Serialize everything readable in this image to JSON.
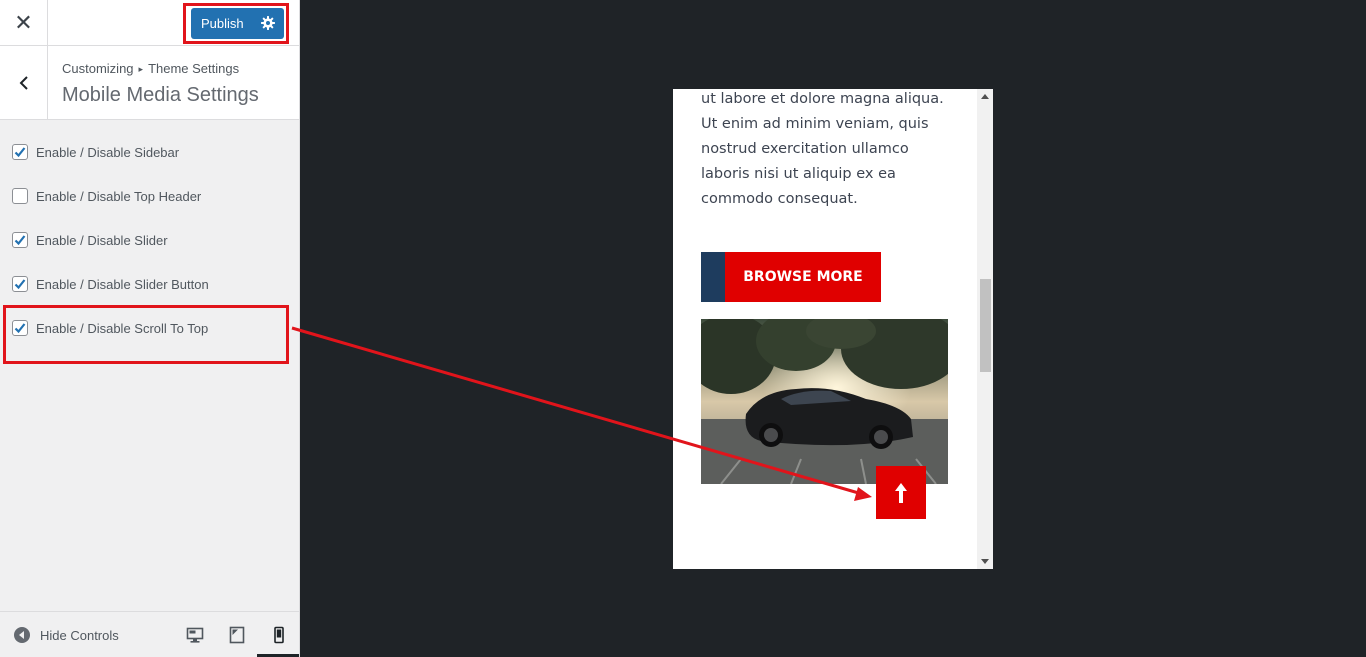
{
  "topbar": {
    "close_icon": "close-icon",
    "publish_label": "Publish",
    "settings_icon": "gear-icon"
  },
  "section": {
    "breadcrumb_root": "Customizing",
    "breadcrumb_separator": "▸",
    "breadcrumb_parent": "Theme Settings",
    "title": "Mobile Media Settings"
  },
  "options": [
    {
      "label": "Enable / Disable Sidebar",
      "checked": true
    },
    {
      "label": "Enable / Disable Top Header",
      "checked": false
    },
    {
      "label": "Enable / Disable Slider",
      "checked": true
    },
    {
      "label": "Enable / Disable Slider Button",
      "checked": true
    },
    {
      "label": "Enable / Disable Scroll To Top",
      "checked": true
    }
  ],
  "footer": {
    "hide_controls_label": "Hide Controls",
    "devices": [
      "desktop-icon",
      "tablet-icon",
      "mobile-icon"
    ],
    "active_device": "mobile"
  },
  "preview": {
    "body_text": "ut labore et dolore magna aliqua. Ut enim ad minim veniam, quis nostrud exercitation ullamco laboris nisi ut aliquip ex ea commodo consequat.",
    "button_label": "BROWSE MORE",
    "image_alt": "black sports car",
    "scroll_top_icon": "arrow-up-icon"
  },
  "colors": {
    "accent": "#2271b1",
    "highlight": "#e1141b",
    "theme_red": "#e00000",
    "theme_navy": "#1e3c5e",
    "preview_bg": "#1f2327"
  }
}
